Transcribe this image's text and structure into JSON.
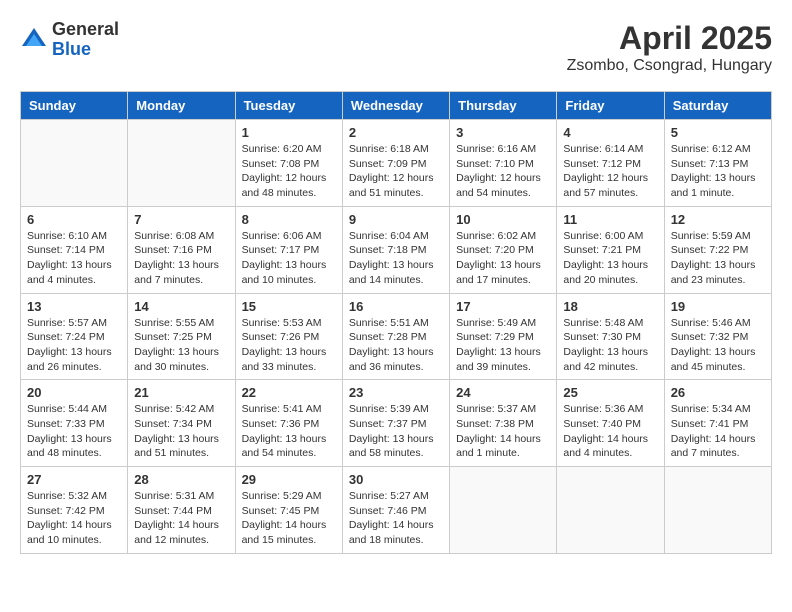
{
  "header": {
    "logo_general": "General",
    "logo_blue": "Blue",
    "title": "April 2025",
    "location": "Zsombo, Csongrad, Hungary"
  },
  "weekdays": [
    "Sunday",
    "Monday",
    "Tuesday",
    "Wednesday",
    "Thursday",
    "Friday",
    "Saturday"
  ],
  "weeks": [
    [
      {
        "day": "",
        "info": ""
      },
      {
        "day": "",
        "info": ""
      },
      {
        "day": "1",
        "info": "Sunrise: 6:20 AM\nSunset: 7:08 PM\nDaylight: 12 hours and 48 minutes."
      },
      {
        "day": "2",
        "info": "Sunrise: 6:18 AM\nSunset: 7:09 PM\nDaylight: 12 hours and 51 minutes."
      },
      {
        "day": "3",
        "info": "Sunrise: 6:16 AM\nSunset: 7:10 PM\nDaylight: 12 hours and 54 minutes."
      },
      {
        "day": "4",
        "info": "Sunrise: 6:14 AM\nSunset: 7:12 PM\nDaylight: 12 hours and 57 minutes."
      },
      {
        "day": "5",
        "info": "Sunrise: 6:12 AM\nSunset: 7:13 PM\nDaylight: 13 hours and 1 minute."
      }
    ],
    [
      {
        "day": "6",
        "info": "Sunrise: 6:10 AM\nSunset: 7:14 PM\nDaylight: 13 hours and 4 minutes."
      },
      {
        "day": "7",
        "info": "Sunrise: 6:08 AM\nSunset: 7:16 PM\nDaylight: 13 hours and 7 minutes."
      },
      {
        "day": "8",
        "info": "Sunrise: 6:06 AM\nSunset: 7:17 PM\nDaylight: 13 hours and 10 minutes."
      },
      {
        "day": "9",
        "info": "Sunrise: 6:04 AM\nSunset: 7:18 PM\nDaylight: 13 hours and 14 minutes."
      },
      {
        "day": "10",
        "info": "Sunrise: 6:02 AM\nSunset: 7:20 PM\nDaylight: 13 hours and 17 minutes."
      },
      {
        "day": "11",
        "info": "Sunrise: 6:00 AM\nSunset: 7:21 PM\nDaylight: 13 hours and 20 minutes."
      },
      {
        "day": "12",
        "info": "Sunrise: 5:59 AM\nSunset: 7:22 PM\nDaylight: 13 hours and 23 minutes."
      }
    ],
    [
      {
        "day": "13",
        "info": "Sunrise: 5:57 AM\nSunset: 7:24 PM\nDaylight: 13 hours and 26 minutes."
      },
      {
        "day": "14",
        "info": "Sunrise: 5:55 AM\nSunset: 7:25 PM\nDaylight: 13 hours and 30 minutes."
      },
      {
        "day": "15",
        "info": "Sunrise: 5:53 AM\nSunset: 7:26 PM\nDaylight: 13 hours and 33 minutes."
      },
      {
        "day": "16",
        "info": "Sunrise: 5:51 AM\nSunset: 7:28 PM\nDaylight: 13 hours and 36 minutes."
      },
      {
        "day": "17",
        "info": "Sunrise: 5:49 AM\nSunset: 7:29 PM\nDaylight: 13 hours and 39 minutes."
      },
      {
        "day": "18",
        "info": "Sunrise: 5:48 AM\nSunset: 7:30 PM\nDaylight: 13 hours and 42 minutes."
      },
      {
        "day": "19",
        "info": "Sunrise: 5:46 AM\nSunset: 7:32 PM\nDaylight: 13 hours and 45 minutes."
      }
    ],
    [
      {
        "day": "20",
        "info": "Sunrise: 5:44 AM\nSunset: 7:33 PM\nDaylight: 13 hours and 48 minutes."
      },
      {
        "day": "21",
        "info": "Sunrise: 5:42 AM\nSunset: 7:34 PM\nDaylight: 13 hours and 51 minutes."
      },
      {
        "day": "22",
        "info": "Sunrise: 5:41 AM\nSunset: 7:36 PM\nDaylight: 13 hours and 54 minutes."
      },
      {
        "day": "23",
        "info": "Sunrise: 5:39 AM\nSunset: 7:37 PM\nDaylight: 13 hours and 58 minutes."
      },
      {
        "day": "24",
        "info": "Sunrise: 5:37 AM\nSunset: 7:38 PM\nDaylight: 14 hours and 1 minute."
      },
      {
        "day": "25",
        "info": "Sunrise: 5:36 AM\nSunset: 7:40 PM\nDaylight: 14 hours and 4 minutes."
      },
      {
        "day": "26",
        "info": "Sunrise: 5:34 AM\nSunset: 7:41 PM\nDaylight: 14 hours and 7 minutes."
      }
    ],
    [
      {
        "day": "27",
        "info": "Sunrise: 5:32 AM\nSunset: 7:42 PM\nDaylight: 14 hours and 10 minutes."
      },
      {
        "day": "28",
        "info": "Sunrise: 5:31 AM\nSunset: 7:44 PM\nDaylight: 14 hours and 12 minutes."
      },
      {
        "day": "29",
        "info": "Sunrise: 5:29 AM\nSunset: 7:45 PM\nDaylight: 14 hours and 15 minutes."
      },
      {
        "day": "30",
        "info": "Sunrise: 5:27 AM\nSunset: 7:46 PM\nDaylight: 14 hours and 18 minutes."
      },
      {
        "day": "",
        "info": ""
      },
      {
        "day": "",
        "info": ""
      },
      {
        "day": "",
        "info": ""
      }
    ]
  ]
}
